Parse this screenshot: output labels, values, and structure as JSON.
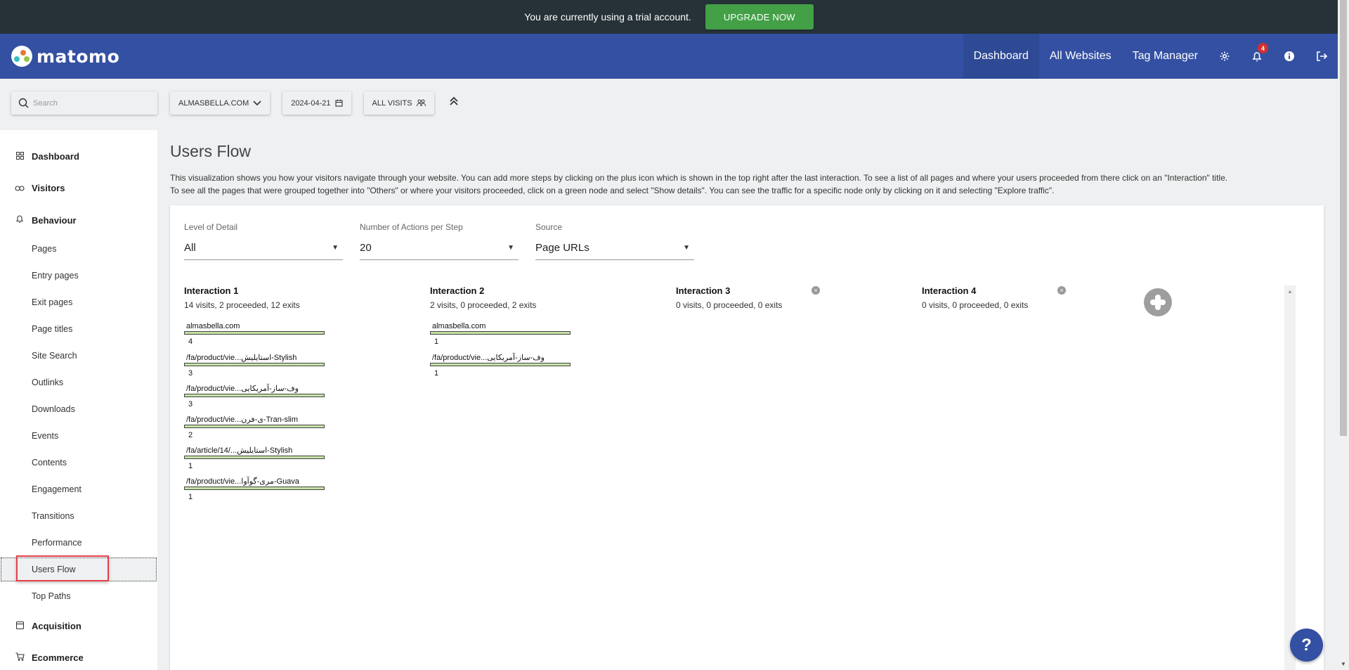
{
  "trial": {
    "message": "You are currently using a trial account.",
    "upgrade_label": "UPGRADE NOW"
  },
  "header": {
    "logo_text": "matomo",
    "nav": [
      "Dashboard",
      "All Websites",
      "Tag Manager"
    ],
    "active_nav": "Dashboard",
    "notification_count": "4",
    "icons": [
      "gear-icon",
      "bell-icon",
      "info-icon",
      "logout-icon"
    ]
  },
  "controls": {
    "search_placeholder": "Search",
    "site": "ALMASBELLA.COM",
    "date": "2024-04-21",
    "segment": "ALL VISITS"
  },
  "sidebar": {
    "categories": [
      {
        "label": "Dashboard",
        "icon": "dashboard-icon"
      },
      {
        "label": "Visitors",
        "icon": "visitors-icon"
      },
      {
        "label": "Behaviour",
        "icon": "bell-icon"
      },
      {
        "label": "Acquisition",
        "icon": "acquisition-icon"
      },
      {
        "label": "Ecommerce",
        "icon": "cart-icon"
      }
    ],
    "behaviour_items": [
      "Pages",
      "Entry pages",
      "Exit pages",
      "Page titles",
      "Site Search",
      "Outlinks",
      "Downloads",
      "Events",
      "Contents",
      "Engagement",
      "Transitions",
      "Performance",
      "Users Flow",
      "Top Paths"
    ],
    "active_item": "Users Flow"
  },
  "main": {
    "title": "Users Flow",
    "description_1": "This visualization shows you how your visitors navigate through your website. You can add more steps by clicking on the plus icon which is shown in the top right after the last interaction. To see a list of all pages and where your users proceeded from there click on an \"Interaction\" title.",
    "description_2": "To see all the pages that were grouped together into \"Others\" or where your visitors proceeded, click on a green node and select \"Show details\". You can see the traffic for a specific node only by clicking on it and selecting \"Explore traffic\".",
    "filters": {
      "level_label": "Level of Detail",
      "level_value": "All",
      "actions_label": "Number of Actions per Step",
      "actions_value": "20",
      "source_label": "Source",
      "source_value": "Page URLs"
    },
    "interactions": [
      {
        "title": "Interaction 1",
        "summary": "14 visits, 2 proceeded, 12 exits",
        "nodes": [
          {
            "label": "almasbella.com",
            "count": "4"
          },
          {
            "label": "/fa/product/vie...استایلیش-Stylish",
            "count": "3"
          },
          {
            "label": "/fa/product/vie...وف-ساز-آمریکایی",
            "count": "3"
          },
          {
            "label": "/fa/product/vie...ی-فرن-Tran-slim",
            "count": "2"
          },
          {
            "label": "/fa/article/14/...استایلیش-Stylish",
            "count": "1"
          },
          {
            "label": "/fa/product/vie...مری-گوآوا-Guava",
            "count": "1"
          }
        ]
      },
      {
        "title": "Interaction 2",
        "summary": "2 visits, 0 proceeded, 2 exits",
        "nodes": [
          {
            "label": "almasbella.com",
            "count": "1"
          },
          {
            "label": "/fa/product/vie...وف-ساز-آمریکایی",
            "count": "1"
          }
        ]
      },
      {
        "title": "Interaction 3",
        "summary": "0 visits, 0 proceeded, 0 exits",
        "nodes": []
      },
      {
        "title": "Interaction 4",
        "summary": "0 visits, 0 proceeded, 0 exits",
        "nodes": []
      }
    ]
  },
  "help_label": "?"
}
